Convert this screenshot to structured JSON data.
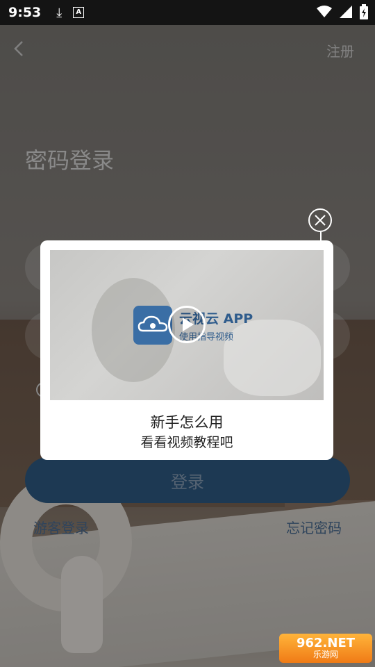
{
  "status_bar": {
    "time": "9:53",
    "download_icon": "download-icon",
    "font_icon_label": "A"
  },
  "header": {
    "register": "注册"
  },
  "login": {
    "title": "密码登录",
    "button": "登录",
    "guest": "游客登录",
    "forgot": "忘记密码"
  },
  "dialog": {
    "video": {
      "app_name": "云视云 APP",
      "app_subtitle": "使用指导视频"
    },
    "title": "新手怎么用",
    "subtitle": "看看视频教程吧"
  },
  "watermark": {
    "main": "962.NET",
    "sub": "乐游网"
  },
  "colors": {
    "accent": "#2f5c86",
    "link": "#4d6f95",
    "status_bar": "#141414"
  }
}
